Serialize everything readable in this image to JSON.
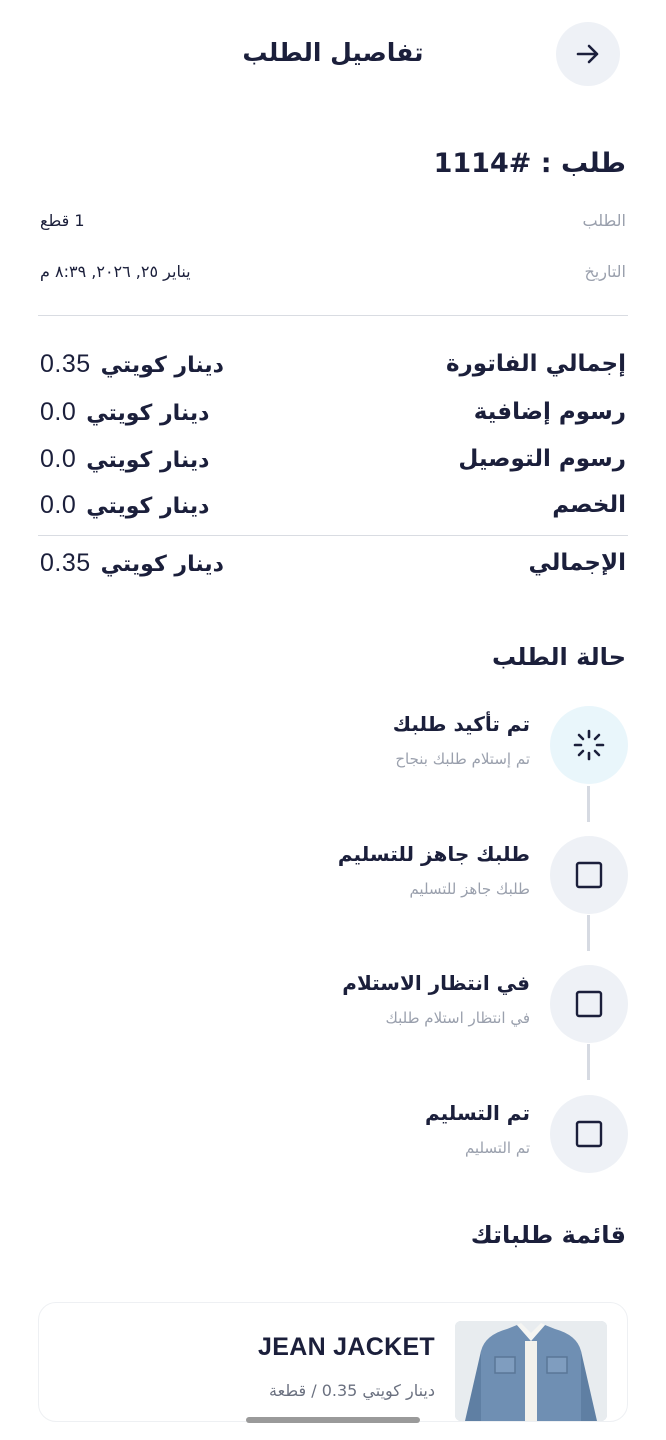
{
  "header": {
    "title": "تفاصيل الطلب",
    "back_icon": "arrow-right-icon"
  },
  "order": {
    "number_text": "طلب : #1114",
    "items_label": "الطلب",
    "items_value": "1 قطع",
    "date_label": "التاريخ",
    "date_value": "يناير ٢٥, ٢٠٢٦, ٨:٣٩ م"
  },
  "summary": {
    "currency": "دينار كويتي",
    "rows": [
      {
        "label": "إجمالي الفاتورة",
        "amount": "0.35"
      },
      {
        "label": "رسوم إضافية",
        "amount": "0.0"
      },
      {
        "label": "رسوم التوصيل",
        "amount": "0.0"
      },
      {
        "label": "الخصم",
        "amount": "0.0"
      }
    ],
    "total": {
      "label": "الإجمالي",
      "amount": "0.35"
    }
  },
  "status": {
    "title": "حالة الطلب",
    "steps": [
      {
        "title": "تم تأكيد طلبك",
        "subtitle": "تم إستلام طلبك بنجاح",
        "icon": "spinner-icon",
        "active": true
      },
      {
        "title": "طلبك جاهز للتسليم",
        "subtitle": "طلبك جاهز للتسليم",
        "icon": "square-icon",
        "active": false
      },
      {
        "title": "في انتظار الاستلام",
        "subtitle": "في انتظار استلام طلبك",
        "icon": "square-icon",
        "active": false
      },
      {
        "title": "تم التسليم",
        "subtitle": "تم التسليم",
        "icon": "square-icon",
        "active": false
      }
    ]
  },
  "orders_list": {
    "title": "قائمة طلباتك",
    "items": [
      {
        "name": "JEAN JACKET",
        "price_text": "دينار كويتي 0.35 / قطعة",
        "image": "denim-jacket-image"
      }
    ]
  },
  "colors": {
    "accent": "#1b1f3b",
    "muted": "#9aa0ad",
    "circle_bg": "#eef1f6",
    "active_bg": "#e9f6fb"
  }
}
